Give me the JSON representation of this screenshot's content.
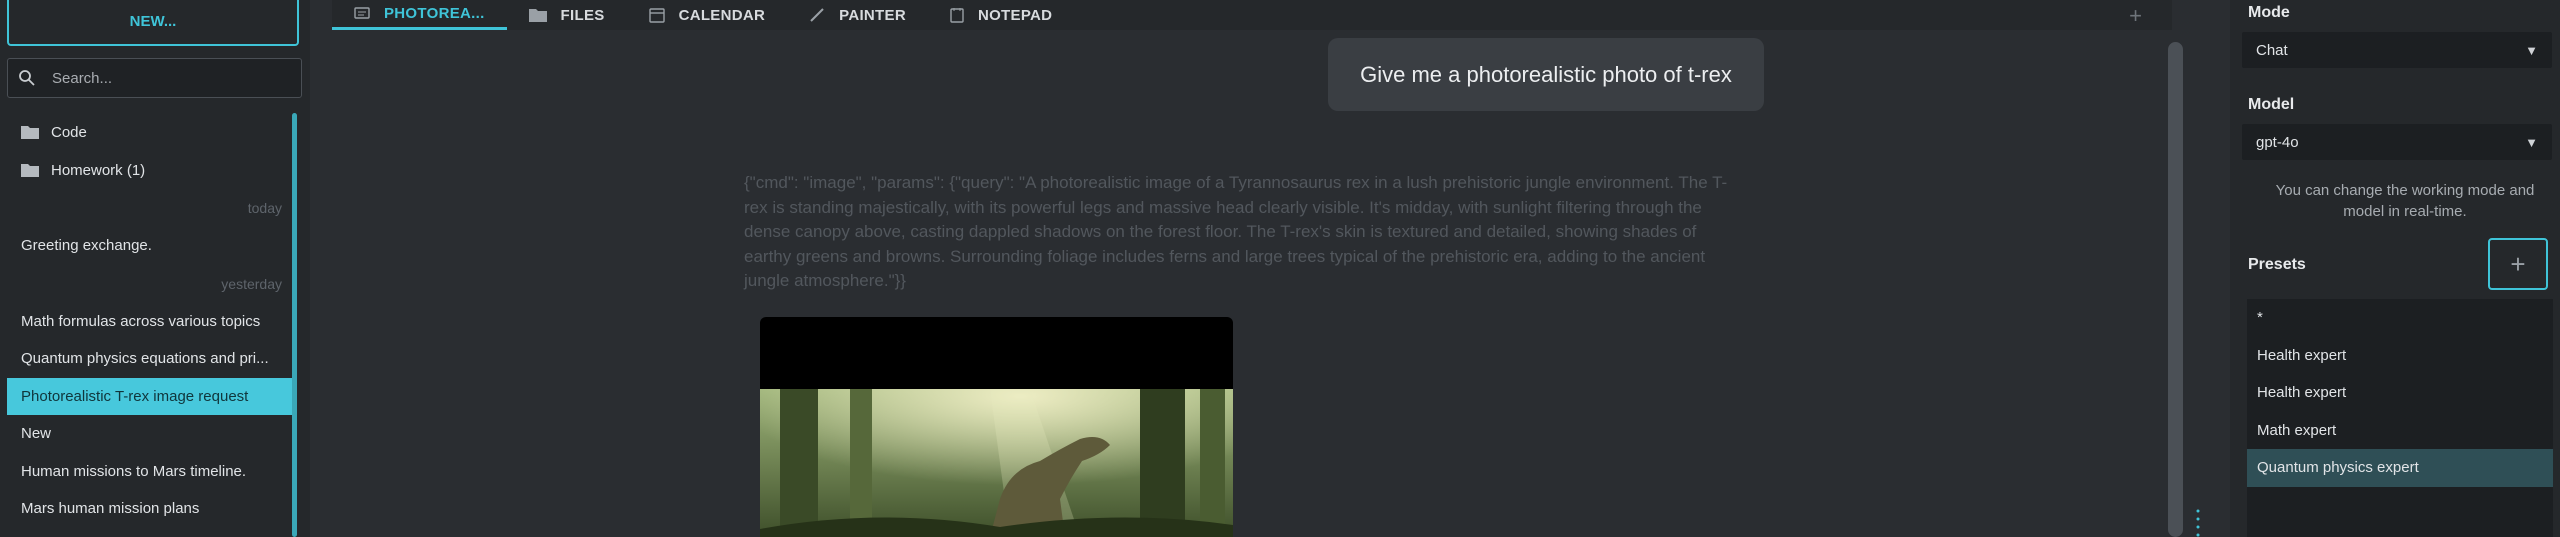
{
  "sidebar": {
    "new_label": "NEW...",
    "search_placeholder": "Search...",
    "folders": [
      "Code",
      "Homework (1)"
    ],
    "groups": {
      "today_label": "today",
      "today_items": [
        "Greeting exchange."
      ],
      "yesterday_label": "yesterday",
      "yesterday_items": [
        "Math formulas across various topics",
        "Quantum physics equations and pri...",
        "Photorealistic T-rex image request",
        "New",
        "Human missions to Mars timeline.",
        "Mars human mission plans"
      ]
    }
  },
  "tabs": [
    {
      "label": "PHOTOREA...",
      "icon": "chat-icon"
    },
    {
      "label": "FILES",
      "icon": "folder-icon"
    },
    {
      "label": "CALENDAR",
      "icon": "calendar-icon"
    },
    {
      "label": "PAINTER",
      "icon": "brush-icon"
    },
    {
      "label": "NOTEPAD",
      "icon": "notepad-icon"
    }
  ],
  "chat": {
    "user_message": "Give me a photorealistic photo of t-rex",
    "command_text": "{\"cmd\": \"image\", \"params\": {\"query\": \"A photorealistic image of a Tyrannosaurus rex in a lush prehistoric jungle environment. The T-rex is standing majestically, with its powerful legs and massive head clearly visible. It's midday, with sunlight filtering through the dense canopy above, casting dappled shadows on the forest floor. The T-rex's skin is textured and detailed, showing shades of earthy greens and browns. Surrounding foliage includes ferns and large trees typical of the prehistoric era, adding to the ancient jungle atmosphere.\"}}"
  },
  "settings": {
    "mode_label": "Mode",
    "mode_value": "Chat",
    "model_label": "Model",
    "model_value": "gpt-4o",
    "help_text": "You can change the working mode and model in real-time.",
    "presets_label": "Presets",
    "presets": [
      "*",
      "Health expert",
      "Health expert",
      "Math expert",
      "Quantum physics expert"
    ]
  },
  "colors": {
    "accent": "#3fc4d8",
    "background": "#2a2d31",
    "panel": "#25282b"
  }
}
